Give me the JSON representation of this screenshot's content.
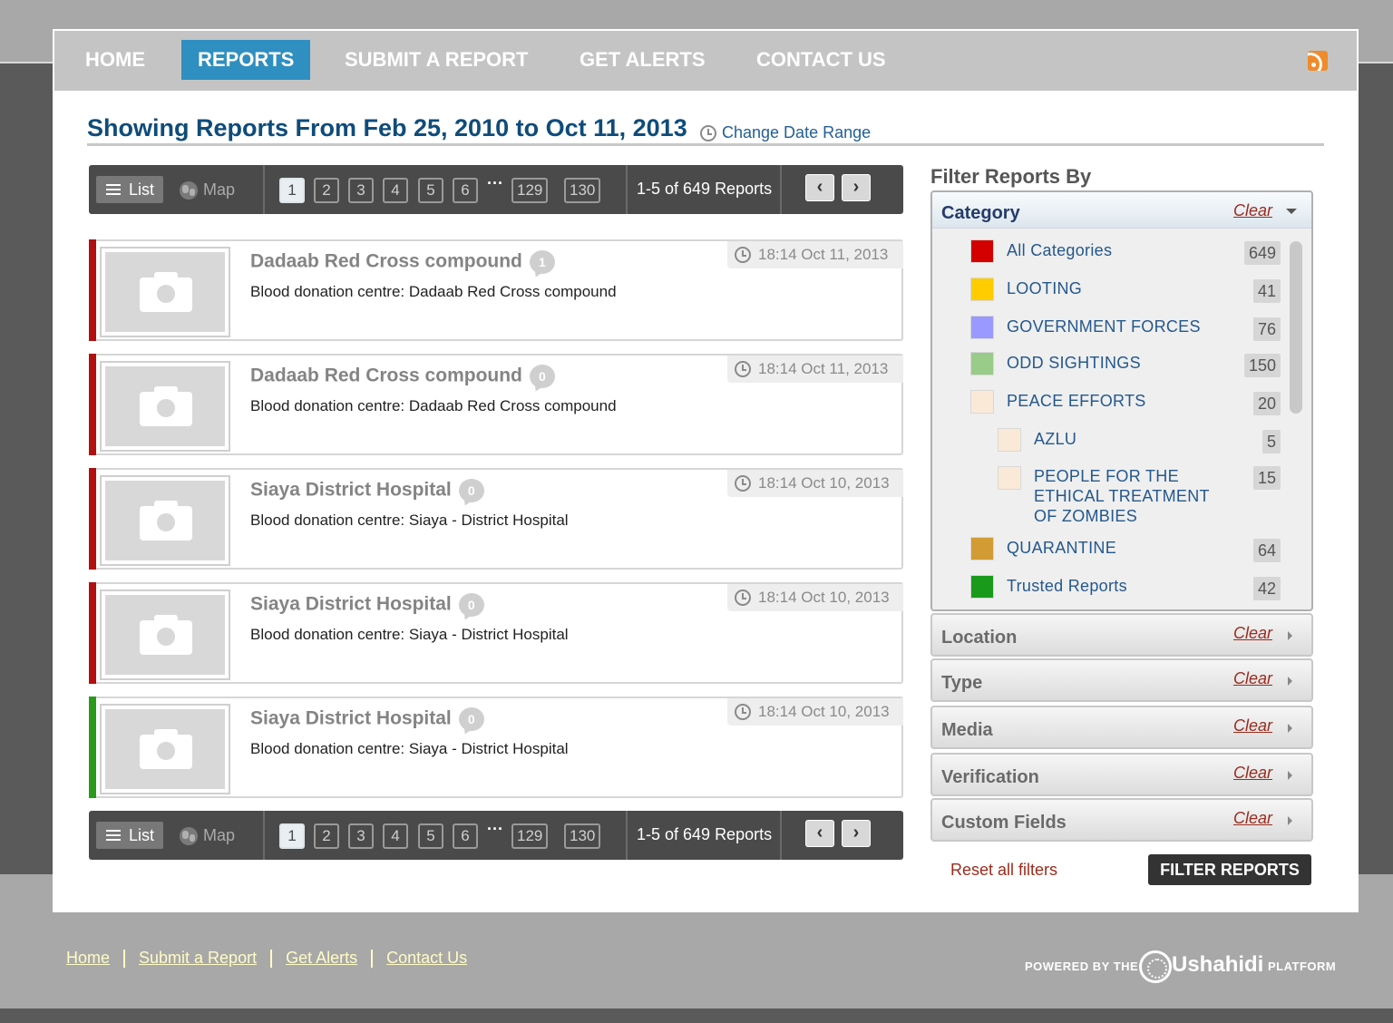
{
  "nav": {
    "items": [
      {
        "label": "HOME",
        "active": false
      },
      {
        "label": "REPORTS",
        "active": true
      },
      {
        "label": "SUBMIT A REPORT",
        "active": false
      },
      {
        "label": "GET ALERTS",
        "active": false
      },
      {
        "label": "CONTACT US",
        "active": false
      }
    ],
    "rss_icon": "rss-icon"
  },
  "header": {
    "title": "Showing Reports From Feb 25, 2010 to Oct 11, 2013",
    "change_range": "Change Date Range"
  },
  "pager": {
    "list_label": "List",
    "map_label": "Map",
    "pages": [
      "1",
      "2",
      "3",
      "4",
      "5",
      "6",
      "129",
      "130"
    ],
    "ellipsis": "···",
    "active_page": "1",
    "count": "1-5 of 649 Reports",
    "prev": "‹",
    "next": "›"
  },
  "reports": [
    {
      "title": "Dadaab Red Cross compound",
      "comments": "1",
      "description": "Blood donation centre: Dadaab Red Cross compound",
      "date": "18:14 Oct 11, 2013",
      "color": "#b01010"
    },
    {
      "title": "Dadaab Red Cross compound",
      "comments": "0",
      "description": "Blood donation centre: Dadaab Red Cross compound",
      "date": "18:14 Oct 11, 2013",
      "color": "#b01010"
    },
    {
      "title": "Siaya District Hospital",
      "comments": "0",
      "description": "Blood donation centre: Siaya - District Hospital",
      "date": "18:14 Oct 10, 2013",
      "color": "#b01010"
    },
    {
      "title": "Siaya District Hospital",
      "comments": "0",
      "description": "Blood donation centre: Siaya - District Hospital",
      "date": "18:14 Oct 10, 2013",
      "color": "#b01010"
    },
    {
      "title": "Siaya District Hospital",
      "comments": "0",
      "description": "Blood donation centre: Siaya - District Hospital",
      "date": "18:14 Oct 10, 2013",
      "color": "#2a9a1a"
    }
  ],
  "filters": {
    "title": "Filter Reports By",
    "category_label": "Category",
    "clear_label": "Clear",
    "categories": [
      {
        "label": "All Categories",
        "count": "649",
        "color": "#d40000"
      },
      {
        "label": "LOOTING",
        "count": "41",
        "color": "#ffcc00"
      },
      {
        "label": "GOVERNMENT FORCES",
        "count": "76",
        "color": "#9999ff"
      },
      {
        "label": "ODD SIGHTINGS",
        "count": "150",
        "color": "#99cc88"
      },
      {
        "label": "PEACE EFFORTS",
        "count": "20",
        "color": "#fbe9d8"
      },
      {
        "label": "AZLU",
        "count": "5",
        "color": "#fbe9d8"
      },
      {
        "label": "PEOPLE FOR THE ETHICAL TREATMENT OF ZOMBIES",
        "count": "15",
        "color": "#fbe9d8"
      },
      {
        "label": "QUARANTINE",
        "count": "64",
        "color": "#d39b33"
      },
      {
        "label": "Trusted Reports",
        "count": "42",
        "color": "#1a9a1a"
      }
    ],
    "sections": [
      "Location",
      "Type",
      "Media",
      "Verification",
      "Custom Fields"
    ],
    "reset": "Reset all filters",
    "submit": "FILTER REPORTS"
  },
  "footer": {
    "links": [
      "Home",
      "Submit a Report",
      "Get Alerts",
      "Contact Us"
    ],
    "powered": "POWERED BY THE",
    "brand": "Ushahidi",
    "platform": "PLATFORM"
  }
}
